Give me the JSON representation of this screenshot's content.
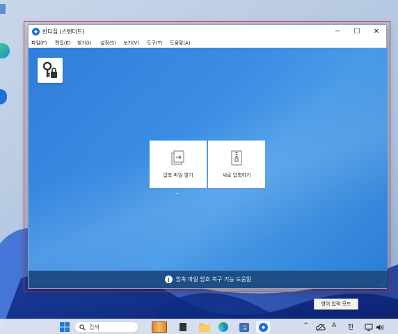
{
  "window": {
    "title": "반디집 (스탠더드)",
    "controls": {
      "minimize": "─",
      "maximize": "☐",
      "close": "✕"
    }
  },
  "menu": [
    "파일(F)",
    "편집(E)",
    "찾기(I)",
    "설정(S)",
    "보기(V)",
    "도구(T)",
    "도움말(A)"
  ],
  "cards": [
    {
      "label": "압축 파일 열기"
    },
    {
      "label": "새로 압축하기"
    }
  ],
  "more_chevron": "⌄",
  "footer": {
    "info_glyph": "i",
    "text": "압축 파일 암호 복구 기능 도움말"
  },
  "tooltip": "영어 입력 모드",
  "taskbar": {
    "search_placeholder": "검색",
    "tray": {
      "chevron": "^",
      "ime_a": "A",
      "ime_han": "한"
    }
  },
  "colors": {
    "content_blue": "#3a8de3",
    "footer_blue": "#1d4f86",
    "selection_red": "#e0232b"
  },
  "icons": [
    "bandizip-logo-icon",
    "key-lock-icon",
    "open-archive-icon",
    "new-archive-icon",
    "info-icon",
    "windows-start-icon",
    "search-icon"
  ]
}
